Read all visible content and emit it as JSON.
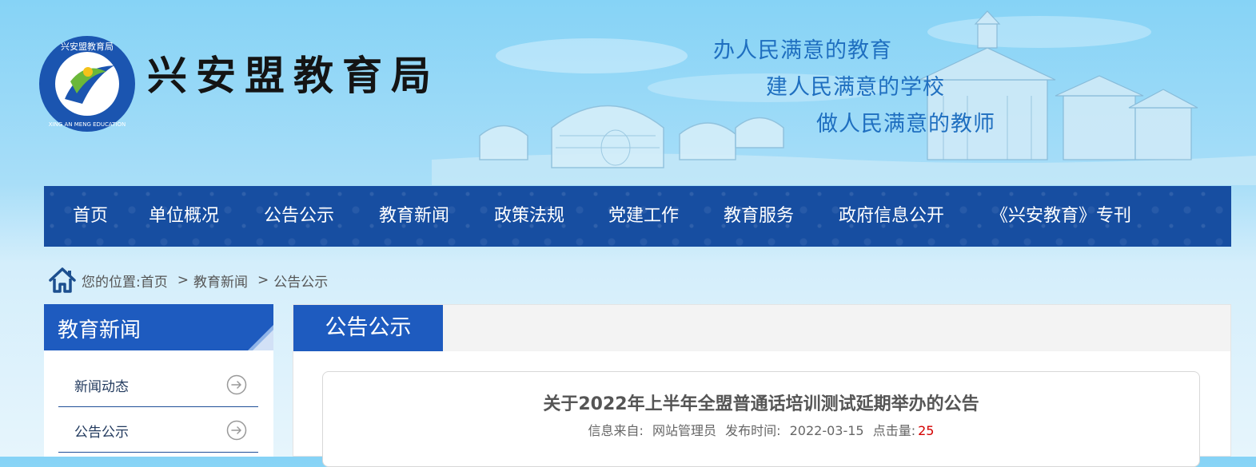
{
  "header": {
    "site_title": "兴安盟教育局",
    "logo_text": "兴安盟教育局 XING AN MENG EDUCATION",
    "slogans": [
      "办人民满意的教育",
      "建人民满意的学校",
      "做人民满意的教师"
    ]
  },
  "nav": {
    "items": [
      "首页",
      "单位概况",
      "公告公示",
      "教育新闻",
      "政策法规",
      "党建工作",
      "教育服务",
      "政府信息公开",
      "《兴安教育》专刊"
    ]
  },
  "breadcrumb": {
    "prefix": "您的位置:",
    "items": [
      "首页",
      "教育新闻",
      "公告公示"
    ],
    "separator": ">"
  },
  "sidebar": {
    "title": "教育新闻",
    "items": [
      "新闻动态",
      "公告公示"
    ]
  },
  "main": {
    "tab_title": "公告公示",
    "article": {
      "title": "关于2022年上半年全盟普通话培训测试延期举办的公告",
      "source_label": "信息来自:",
      "source": "网站管理员",
      "date_label": "发布时间:",
      "date": "2022-03-15",
      "hits_label": "点击量:",
      "hits": "25"
    }
  },
  "colors": {
    "nav_bg": "#174ea1",
    "accent_blue": "#1e5bbf",
    "slogan": "#1f6fc0",
    "hits_red": "#d40000"
  }
}
